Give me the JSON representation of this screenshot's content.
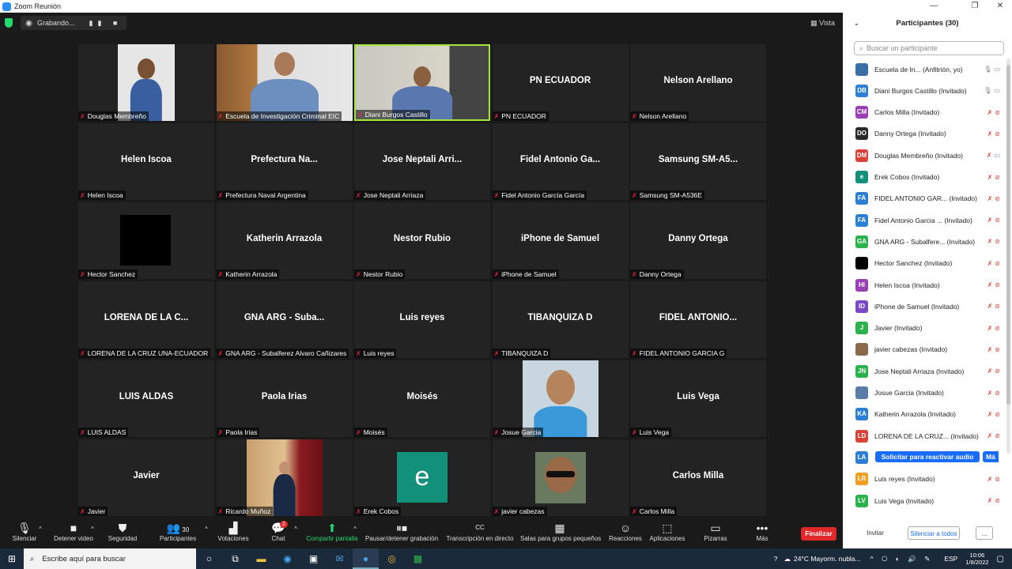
{
  "window": {
    "title": "Zoom Reunión"
  },
  "recording": {
    "label": "Grabando..."
  },
  "view": {
    "label": "Vista"
  },
  "tiles": [
    {
      "big": "",
      "label": "Douglas Membreño",
      "photo": "person"
    },
    {
      "big": "",
      "label": "Escuela de Investigación Criminal EIC",
      "photo": "office"
    },
    {
      "big": "",
      "label": "Diani Burgos Castillo",
      "photo": "officer",
      "active": true
    },
    {
      "big": "PN ECUADOR",
      "label": "PN ECUADOR"
    },
    {
      "big": "Nelson Arellano",
      "label": "Nelson Arellano"
    },
    {
      "big": "Helen Iscoa",
      "label": "Helen Iscoa"
    },
    {
      "big": "Prefectura Na...",
      "label": "Prefectura Naval Argentina"
    },
    {
      "big": "Jose Neptali Arri...",
      "label": "Jose Neptali Arriaza"
    },
    {
      "big": "Fidel Antonio Ga...",
      "label": "Fidel Antonio García García"
    },
    {
      "big": "Samsung SM-A5...",
      "label": "Samsung SM-A536E"
    },
    {
      "big": "",
      "label": "Hector Sanchez",
      "photo": "black"
    },
    {
      "big": "Katherin Arrazola",
      "label": "Katherin Arrazola"
    },
    {
      "big": "Nestor Rubio",
      "label": "Nestor Rubio"
    },
    {
      "big": "iPhone de Samuel",
      "label": "iPhone de Samuel"
    },
    {
      "big": "Danny Ortega",
      "label": "Danny Ortega"
    },
    {
      "big": "LORENA DE LA C...",
      "label": "LORENA DE LA CRUZ UNA-ECUADOR"
    },
    {
      "big": "GNA ARG - Suba...",
      "label": "GNA ARG - Subalferez Alvaro Cañizares"
    },
    {
      "big": "Luis reyes",
      "label": "Luis reyes"
    },
    {
      "big": "TIBANQUIZA D",
      "label": "TIBANQUIZA D"
    },
    {
      "big": "FIDEL ANTONIO...",
      "label": "FIDEL ANTONIO GARCIA G"
    },
    {
      "big": "LUIS ALDAS",
      "label": "LUIS ALDAS"
    },
    {
      "big": "Paola Irias",
      "label": "Paola Irias"
    },
    {
      "big": "Moisés",
      "label": "Moisés"
    },
    {
      "big": "",
      "label": "Josue Garcia",
      "photo": "selfie"
    },
    {
      "big": "Luis Vega",
      "label": "Luis Vega"
    },
    {
      "big": "Javier",
      "label": "Javier"
    },
    {
      "big": "",
      "label": "Ricardo Muñoz",
      "photo": "podium"
    },
    {
      "big": "",
      "label": "Erek Cobos",
      "photo": "e-logo"
    },
    {
      "big": "",
      "label": "javier cabezas",
      "photo": "sunglasses"
    },
    {
      "big": "Carlos Milla",
      "label": "Carlos Milla"
    }
  ],
  "erek_logo_letter": "e",
  "toolbar": {
    "mute": "Silenciar",
    "video": "Detener video",
    "security": "Seguridad",
    "participants": "Participantes",
    "participants_count": "30",
    "polls": "Votaciones",
    "chat": "Chat",
    "chat_badge": "2",
    "share": "Compartir pantalla",
    "pause_rec": "Pausar/detener grabación",
    "cc_glyph": "CC",
    "transcription": "Transcripción en directo",
    "breakout": "Salas para grupos pequeños",
    "reactions": "Reacciones",
    "apps": "Aplicaciones",
    "whiteboards": "Pizarras",
    "more": "Más",
    "end": "Finalizar"
  },
  "panel": {
    "title": "Participantes (30)",
    "search_placeholder": "Buscar un participante",
    "participants": [
      {
        "initials": "",
        "name": "Escuela de In... (Anfitrión, yo)",
        "color": "#3a6ea5",
        "icons": "gray"
      },
      {
        "initials": "DB",
        "name": "Diani Burgos Castillo (Invitado)",
        "color": "#2d7fd3",
        "icons": "gray"
      },
      {
        "initials": "CM",
        "name": "Carlos Milla (Invitado)",
        "color": "#9b3fb4",
        "icons": "red"
      },
      {
        "initials": "DO",
        "name": "Danny Ortega (Invitado)",
        "color": "#2a2a2a",
        "icons": "red"
      },
      {
        "initials": "DM",
        "name": "Douglas Membreño (Invitado)",
        "color": "#d9433a",
        "icons": "mixed"
      },
      {
        "initials": "e",
        "name": "Erek Cobos (Invitado)",
        "color": "#12907a",
        "icons": "red"
      },
      {
        "initials": "FA",
        "name": "FIDEL ANTONIO GAR... (Invitado)",
        "color": "#2d7fd3",
        "icons": "red"
      },
      {
        "initials": "FA",
        "name": "Fidel Antonio Garcia ... (Invitado)",
        "color": "#2d7fd3",
        "icons": "red"
      },
      {
        "initials": "GA",
        "name": "GNA ARG - Subalfere... (Invitado)",
        "color": "#2bb24c",
        "icons": "red"
      },
      {
        "initials": "",
        "name": "Hector Sanchez (Invitado)",
        "color": "#000000",
        "icons": "red"
      },
      {
        "initials": "HI",
        "name": "Helen Iscoa (Invitado)",
        "color": "#9b3fb4",
        "icons": "red"
      },
      {
        "initials": "ID",
        "name": "iPhone de Samuel (Invitado)",
        "color": "#7a48c6",
        "icons": "red"
      },
      {
        "initials": "J",
        "name": "Javier (Invitado)",
        "color": "#2bb24c",
        "icons": "red"
      },
      {
        "initials": "",
        "name": "javier cabezas (Invitado)",
        "color": "#8a6a4a",
        "icons": "red"
      },
      {
        "initials": "JN",
        "name": "Jose Neptali Arriaza (Invitado)",
        "color": "#2bb24c",
        "icons": "red"
      },
      {
        "initials": "",
        "name": "Josue Garcia (Invitado)",
        "color": "#5a7da8",
        "icons": "red"
      },
      {
        "initials": "KA",
        "name": "Katherin Arrazola (Invitado)",
        "color": "#2d7fd3",
        "icons": "red"
      },
      {
        "initials": "LD",
        "name": "LORENA DE LA CRUZ... (Invitado)",
        "color": "#d9433a",
        "icons": "red"
      },
      {
        "initials": "LA",
        "name": "",
        "color": "#2d7fd3",
        "icons": "none"
      },
      {
        "initials": "LR",
        "name": "Luis reyes (Invitado)",
        "color": "#f0a020",
        "icons": "red"
      },
      {
        "initials": "LV",
        "name": "Luis Vega (Invitado)",
        "color": "#2bb24c",
        "icons": "red"
      }
    ],
    "request_unmute": "Solicitar para reactivar audio",
    "more_short": "Má",
    "invite": "Invitar",
    "mute_all": "Silenciar a todos",
    "ellipsis": "..."
  },
  "taskbar": {
    "search_placeholder": "Escribe aquí para buscar",
    "weather": "24°C  Mayorm. nubla...",
    "lang": "ESP",
    "time": "10:06",
    "date": "1/8/2022"
  }
}
